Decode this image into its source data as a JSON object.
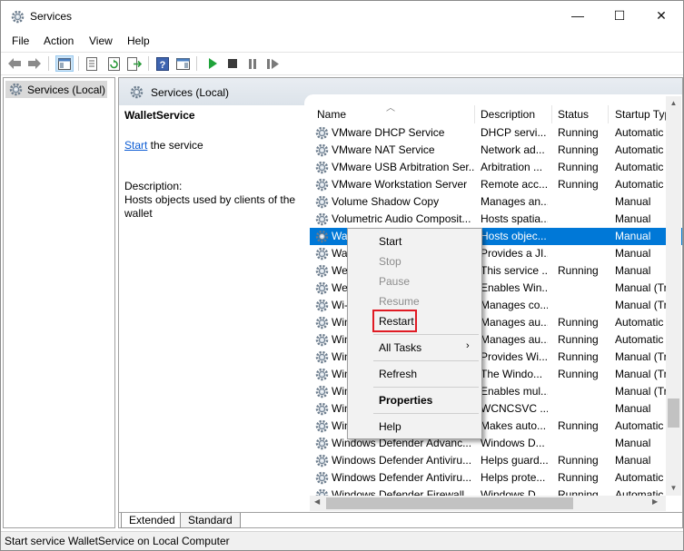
{
  "window": {
    "title": "Services",
    "minimize_glyph": "—",
    "maximize_glyph": "☐",
    "close_glyph": "✕"
  },
  "menu": [
    "File",
    "Action",
    "View",
    "Help"
  ],
  "toolbar_icons": [
    "back-icon",
    "forward-icon",
    "show-hide-console-tree-icon",
    "properties-icon",
    "refresh-icon",
    "export-list-icon",
    "help-icon",
    "show-hide-action-pane-icon",
    "start-service-icon",
    "stop-service-icon",
    "pause-service-icon",
    "restart-service-icon"
  ],
  "tree": {
    "root": "Services (Local)"
  },
  "pane": {
    "title": "Services (Local)",
    "selected_service": "WalletService",
    "start_link": "Start",
    "start_suffix": " the service",
    "description_label": "Description:",
    "description_text": "Hosts objects used by clients of the wallet"
  },
  "table": {
    "columns": [
      "Name",
      "Description",
      "Status",
      "Startup Typ"
    ],
    "rows": [
      [
        "VMware DHCP Service",
        "DHCP servi...",
        "Running",
        "Automatic"
      ],
      [
        "VMware NAT Service",
        "Network ad...",
        "Running",
        "Automatic"
      ],
      [
        "VMware USB Arbitration Ser...",
        "Arbitration ...",
        "Running",
        "Automatic"
      ],
      [
        "VMware Workstation Server",
        "Remote acc...",
        "Running",
        "Automatic"
      ],
      [
        "Volume Shadow Copy",
        "Manages an...",
        "",
        "Manual"
      ],
      [
        "Volumetric Audio Composit...",
        "Hosts spatia...",
        "",
        "Manual"
      ],
      [
        "Wa",
        "Hosts objec...",
        "",
        "Manual"
      ],
      [
        "Wa",
        "Provides a JI...",
        "",
        "Manual"
      ],
      [
        "We",
        "This service ...",
        "Running",
        "Manual"
      ],
      [
        "We",
        "Enables Win...",
        "",
        "Manual (Tr"
      ],
      [
        "Wi-",
        "Manages co...",
        "",
        "Manual (Tr"
      ],
      [
        "Win",
        "Manages au...",
        "Running",
        "Automatic"
      ],
      [
        "Win",
        "Manages au...",
        "Running",
        "Automatic"
      ],
      [
        "Win",
        "Provides Wi...",
        "Running",
        "Manual (Tr"
      ],
      [
        "Win",
        "The Windo...",
        "Running",
        "Manual (Tr"
      ],
      [
        "Win",
        "Enables mul...",
        "",
        "Manual (Tr"
      ],
      [
        "Win",
        "WCNCSVC ...",
        "",
        "Manual"
      ],
      [
        "Win",
        "Makes auto...",
        "Running",
        "Automatic"
      ],
      [
        "Windows Defender Advanc...",
        "Windows D...",
        "",
        "Manual"
      ],
      [
        "Windows Defender Antiviru...",
        "Helps guard...",
        "Running",
        "Manual"
      ],
      [
        "Windows Defender Antiviru...",
        "Helps prote...",
        "Running",
        "Automatic"
      ],
      [
        "Windows Defender Firewall",
        "Windows D...",
        "Running",
        "Automatic"
      ]
    ],
    "selected_index": 6
  },
  "tabs": [
    "Extended",
    "Standard"
  ],
  "context_menu": {
    "start": "Start",
    "stop": "Stop",
    "pause": "Pause",
    "resume": "Resume",
    "restart": "Restart",
    "all_tasks": "All Tasks",
    "refresh": "Refresh",
    "properties": "Properties",
    "help": "Help",
    "submenu_arrow": "›"
  },
  "status_bar": "Start service WalletService on Local Computer",
  "colors": {
    "selection": "#0078d7",
    "highlight_box": "#e01b24",
    "link": "#0b5bd3"
  }
}
